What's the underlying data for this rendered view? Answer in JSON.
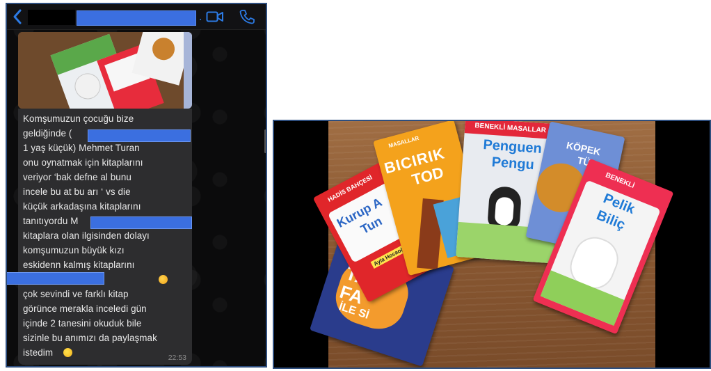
{
  "chat": {
    "header": {
      "back_icon": "chevron-left-icon",
      "video_icon": "video-camera-icon",
      "call_icon": "phone-icon",
      "accent_color": "#2c7be5"
    },
    "message": {
      "text": "Komşumuzun çocuğu bize\ngeldiğinde (\n1 yaş küçük) Mehmet Turan\nonu oynatmak için kitaplarını\nveriyor ‘bak defne al bunu\nincele bu at bu arı ‘ vs die\nküçük arkadaşına kitaplarını\ntanıtıyordu M\nkitaplara olan ilgisinden dolayı\nkomşumuzun büyük kızı\neskidenn kalmış kitaplarını\n                              getirmiş\nçok sevindi ve farklı kitap\ngörünce merakla inceledi gün\niçinde 2 tanesini okuduk bile\nsizinle bu anımızı da paylaşmak\nistedim",
      "time": "22:53"
    }
  },
  "photo": {
    "books": [
      {
        "series": "HADİS BAHÇESİ",
        "title_1": "Kurup A",
        "title_2": "Tun",
        "author": "Ayla Hocaoğlu",
        "color": "#e0262a"
      },
      {
        "series": "MASALLAR",
        "title_1": "BICIRIK",
        "title_2": "TOD",
        "color": "#f4a21c"
      },
      {
        "series": "BENEKLİ MASALLAR",
        "title_1": "Penguen",
        "title_2": "Pengu",
        "color": "#e5e8ee"
      },
      {
        "series": "",
        "title_1": "KÖPEK",
        "title_2": "TÜ",
        "color": "#6e8fd6"
      },
      {
        "series": "BENEKLİ",
        "title_1": "Pelik",
        "title_2": "Biliç",
        "color": "#ee2f52"
      },
      {
        "series": "",
        "title_1": "TA",
        "title_2": "FA",
        "title_3": "İLE Sİ",
        "color": "#2a3c8c"
      }
    ]
  }
}
